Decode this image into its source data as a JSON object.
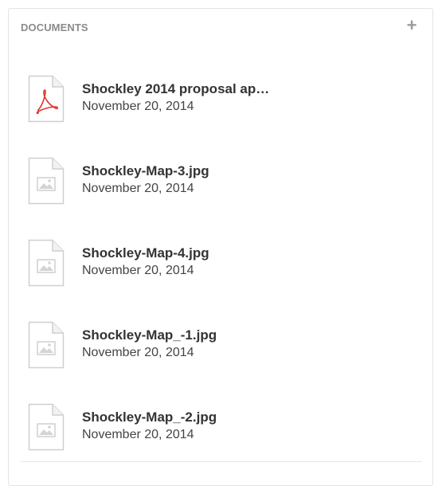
{
  "panel": {
    "title": "DOCUMENTS",
    "add_label": "+"
  },
  "documents": [
    {
      "name": "Shockley 2014 proposal ap…",
      "date": "November 20, 2014",
      "type": "pdf"
    },
    {
      "name": "Shockley-Map-3.jpg",
      "date": "November 20, 2014",
      "type": "image"
    },
    {
      "name": "Shockley-Map-4.jpg",
      "date": "November 20, 2014",
      "type": "image"
    },
    {
      "name": "Shockley-Map_-1.jpg",
      "date": "November 20, 2014",
      "type": "image"
    },
    {
      "name": "Shockley-Map_-2.jpg",
      "date": "November 20, 2014",
      "type": "image"
    }
  ],
  "icons": {
    "pdf": "pdf-file-icon",
    "image": "image-file-icon"
  },
  "colors": {
    "pdf_accent": "#d9332b",
    "title_gray": "#8b8b8b",
    "icon_stroke": "#cfcfcf",
    "text_dark": "#333333"
  }
}
